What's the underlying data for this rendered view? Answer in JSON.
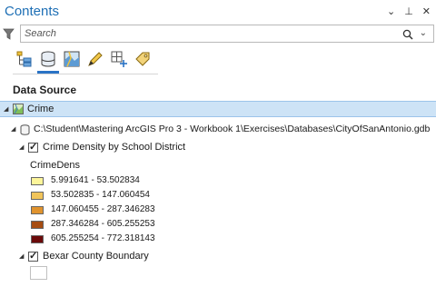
{
  "pane": {
    "title": "Contents",
    "controls": [
      "⌄",
      "⊥",
      "✕"
    ]
  },
  "search": {
    "placeholder": "Search"
  },
  "toolbar": {
    "buttons": [
      "list-by-drawing-order",
      "list-by-data-source",
      "list-by-selection",
      "list-by-editing",
      "list-by-snapping",
      "list-by-labeling"
    ],
    "active": "list-by-data-source"
  },
  "section_title": "Data Source",
  "tree": {
    "map": "Crime",
    "database_path": "C:\\Student\\Mastering ArcGIS Pro 3 - Workbook 1\\Exercises\\Databases\\CityOfSanAntonio.gdb",
    "layer1": {
      "name": "Crime Density by School District",
      "field": "CrimeDens",
      "classes": [
        {
          "label": "5.991641 - 53.502834",
          "color": "#fdf59a"
        },
        {
          "label": "53.502835 - 147.060454",
          "color": "#f1c45a"
        },
        {
          "label": "147.060455 - 287.346283",
          "color": "#e0932e"
        },
        {
          "label": "287.346284 - 605.255253",
          "color": "#a64d12"
        },
        {
          "label": "605.255254 - 772.318143",
          "color": "#6b0a0a"
        }
      ]
    },
    "layer2": {
      "name": "Bexar County Boundary"
    }
  }
}
